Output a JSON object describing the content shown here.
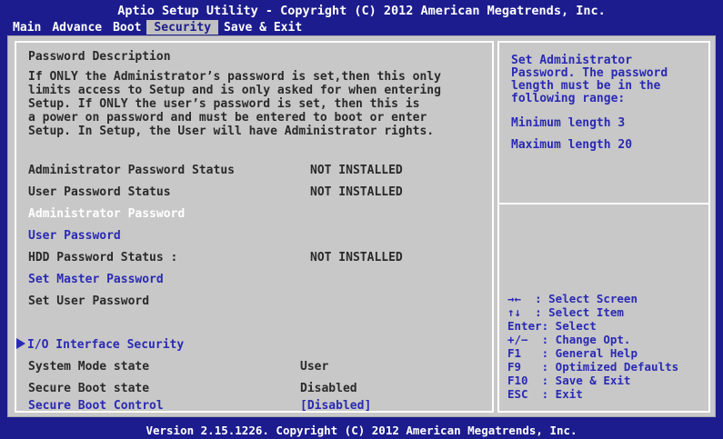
{
  "title": "Aptio Setup Utility - Copyright (C) 2012 American Megatrends, Inc.",
  "tabs": [
    "Main",
    "Advance",
    "Boot",
    "Security",
    "Save & Exit"
  ],
  "active_tab": "Security",
  "description": {
    "heading": "Password Description",
    "lines": [
      "If ONLY the Administrator’s password is set,then this only",
      "limits access to Setup and is only asked for when entering",
      "Setup. If ONLY the user’s password is set, then this is",
      "a power on password and must be entered to boot or enter",
      "Setup. In Setup, the User will have Administrator rights."
    ]
  },
  "items": {
    "admin_status_label": "Administrator Password Status",
    "admin_status_value": "NOT INSTALLED",
    "user_status_label": "User Password Status",
    "user_status_value": "NOT INSTALLED",
    "admin_password": "Administrator Password",
    "user_password": "User Password",
    "hdd_status_label": "HDD Password Status :",
    "hdd_status_value": "NOT INSTALLED",
    "set_master": "Set Master Password",
    "set_user": "Set User Password",
    "io_security": "I/O Interface Security",
    "system_mode_label": "System Mode state",
    "system_mode_value": "User",
    "secure_boot_label": "Secure Boot state",
    "secure_boot_value": "Disabled",
    "secure_boot_control_label": "Secure Boot Control",
    "secure_boot_control_value": "[Disabled]"
  },
  "help": {
    "lines": [
      "Set Administrator",
      "Password. The password",
      "length must be in the",
      "following range:"
    ],
    "min": "Minimum length 3",
    "max": "Maximum length 20"
  },
  "keys": [
    "→←  : Select Screen",
    "↑↓  : Select Item",
    "Enter: Select",
    "+/−  : Change Opt.",
    "F1   : General Help",
    "F9   : Optimized Defaults",
    "F10  : Save & Exit",
    "ESC  : Exit"
  ],
  "footer": "Version 2.15.1226. Copyright (C) 2012 American Megatrends, Inc.",
  "colors": {
    "background": "#1c1c8f",
    "panel": "#c8c8c8",
    "selectable_text": "#2a2ab4",
    "static_text": "#2a2a2a",
    "highlight_text": "#ffffff"
  }
}
